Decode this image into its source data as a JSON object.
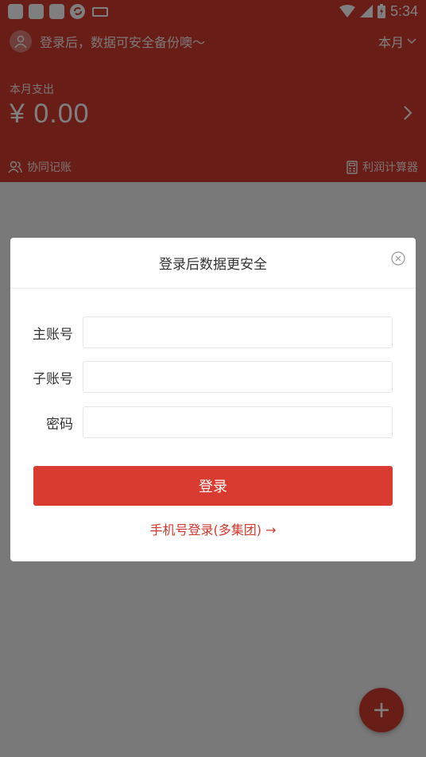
{
  "status_bar": {
    "time": "5:34"
  },
  "header": {
    "login_prompt": "登录后，数据可安全备份噢～",
    "month_selector": "本月",
    "spend_label": "本月支出",
    "spend_amount": "¥ 0.00",
    "collab_label": "协同记账",
    "calculator_label": "利润计算器"
  },
  "dialog": {
    "title": "登录后数据更安全",
    "main_account_label": "主账号",
    "sub_account_label": "子账号",
    "password_label": "密码",
    "main_account_value": "",
    "sub_account_value": "",
    "password_value": "",
    "login_button": "登录",
    "phone_login_link": "手机号登录(多集团)"
  },
  "colors": {
    "brand_red": "#d23a2f",
    "button_red": "#d93b30"
  }
}
